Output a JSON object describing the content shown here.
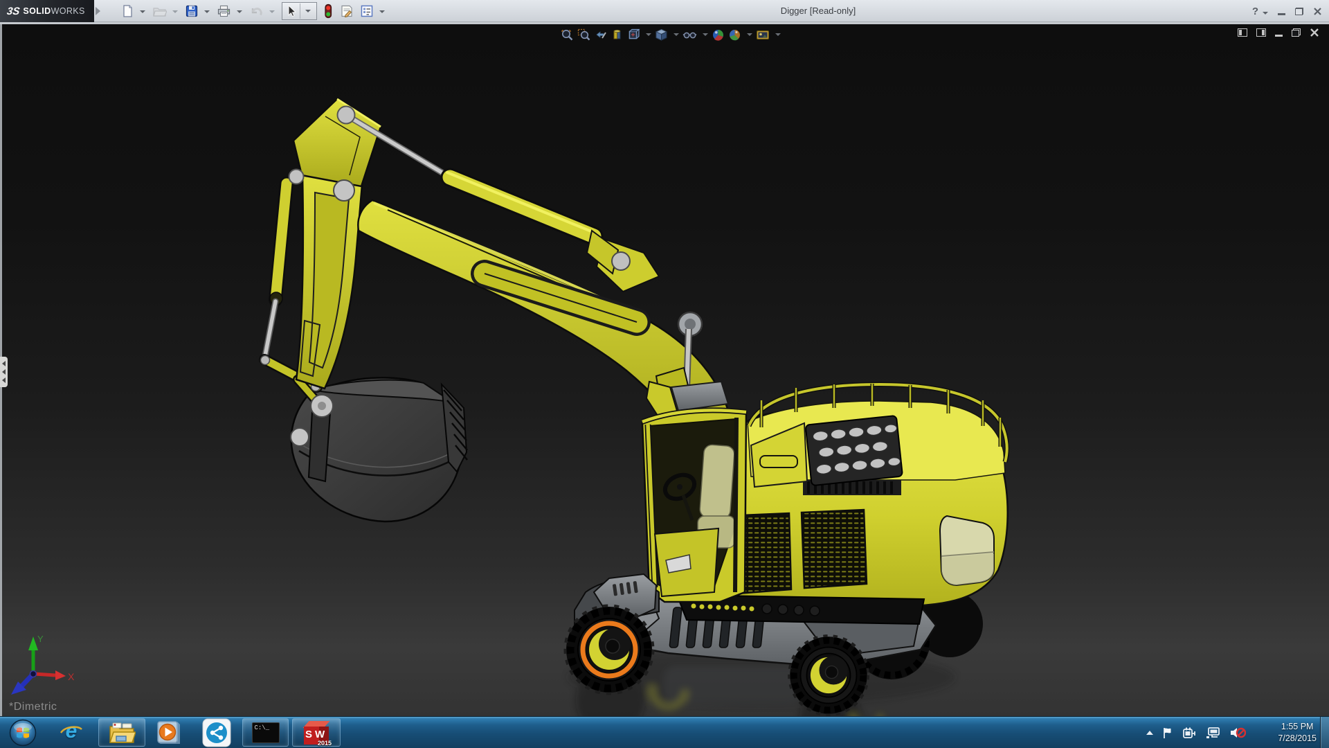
{
  "window": {
    "brand_mark": "3S",
    "brand_bold": "SOLID",
    "brand_light": "WORKS",
    "title": "Digger [Read-only]",
    "help_glyph": "?"
  },
  "quick_access_toolbar": {
    "buttons": [
      {
        "name": "new",
        "enabled": true,
        "dropdown": true
      },
      {
        "name": "open",
        "enabled": false,
        "dropdown": true
      },
      {
        "name": "save",
        "enabled": true,
        "dropdown": true
      },
      {
        "name": "print",
        "enabled": true,
        "dropdown": true
      },
      {
        "name": "undo",
        "enabled": false,
        "dropdown": true
      },
      {
        "name": "select",
        "enabled": true,
        "dropdown": true,
        "active": true
      },
      {
        "name": "rebuild",
        "enabled": true,
        "dropdown": false
      },
      {
        "name": "file-properties",
        "enabled": true,
        "dropdown": false
      },
      {
        "name": "options",
        "enabled": true,
        "dropdown": true
      }
    ]
  },
  "headsup_toolbar": {
    "icons": [
      "zoom-to-fit",
      "zoom-to-area",
      "previous-view",
      "section-view",
      "view-orientation",
      "display-style",
      "hide-show-items",
      "edit-appearance",
      "apply-scene",
      "view-settings"
    ]
  },
  "viewport": {
    "view_label": "*Dimetric",
    "triad": {
      "x_label": "X",
      "y_label": "Y"
    },
    "selection_highlight_color": "#ea7a1c"
  },
  "model": {
    "name": "Digger",
    "body_color": "#d2d230",
    "chassis_color": "#6b6f73",
    "bucket_color": "#3c3c3c",
    "selected_part": "front-wheel-hub"
  },
  "taskbar": {
    "cmd_label": "C:\\_",
    "sw_letters": "SW",
    "sw_badge": "2015",
    "ie_letter": "e",
    "tray": {
      "time": "1:55 PM",
      "date": "7/28/2015"
    }
  }
}
